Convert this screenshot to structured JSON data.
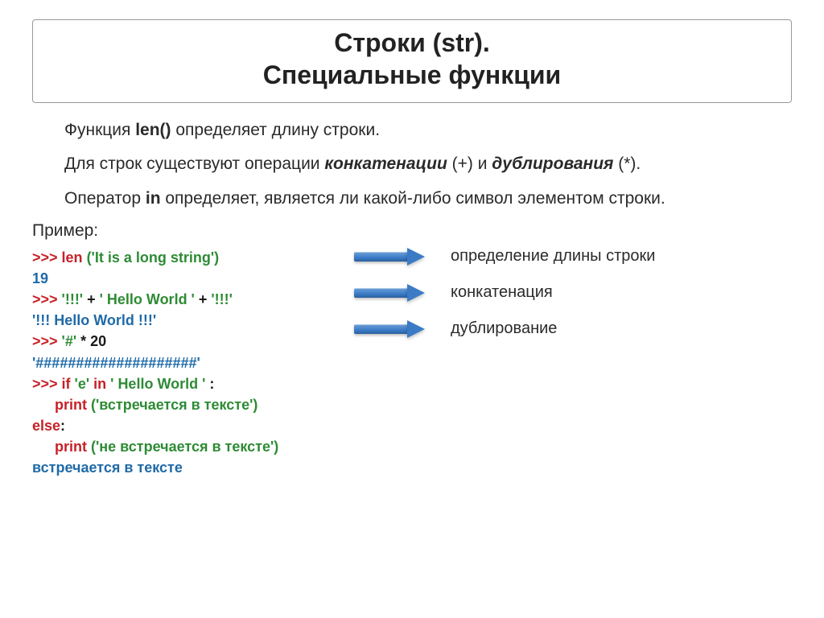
{
  "title": {
    "line1": "Строки (str).",
    "line2": "Специальные функции"
  },
  "para1": {
    "pre": "Функция ",
    "fn": "len()",
    "post": " определяет длину строки."
  },
  "para2": {
    "pre": "Для строк существуют операции ",
    "konkat": "конкатенации",
    "mid": " (+) и ",
    "dubl": "дублирования",
    "post": " (*)."
  },
  "para3": {
    "pre": "Оператор ",
    "op": "in",
    "post": " определяет, является ли какой-либо символ элементом строки."
  },
  "example_label": "Пример:",
  "code": {
    "l1": {
      "prompt": ">>> ",
      "fn": "len ",
      "arg": "('It is a long string')"
    },
    "l2": "19",
    "l3": {
      "prompt": ">>> ",
      "a": "'!!!'",
      "plus1": " + ",
      "b": "' Hello World '",
      "plus2": " + ",
      "c": "'!!!'"
    },
    "l4": "'!!! Hello World !!!'",
    "l5": {
      "prompt": ">>> ",
      "a": "'#'",
      "star": " * ",
      "n": "20"
    },
    "l6": "'####################'",
    "l7": {
      "prompt": ">>> ",
      "kw_if": "if  ",
      "e": "'e'",
      "sp1": "  ",
      "kw_in": "in",
      "sp2": "  ",
      "hw": "' Hello World '",
      "colon": " :"
    },
    "l8": {
      "indent": "        ",
      "fn": "print ",
      "arg": "('встречается в тексте')"
    },
    "l9": "else",
    "l9c": ":",
    "l10": {
      "indent": "        ",
      "fn": "print ",
      "arg": "('не встречается в тексте')"
    },
    "l11": "встречается в тексте"
  },
  "captions": {
    "c1": "определение длины строки",
    "c2": "конкатенация",
    "c3": "дублирование"
  }
}
